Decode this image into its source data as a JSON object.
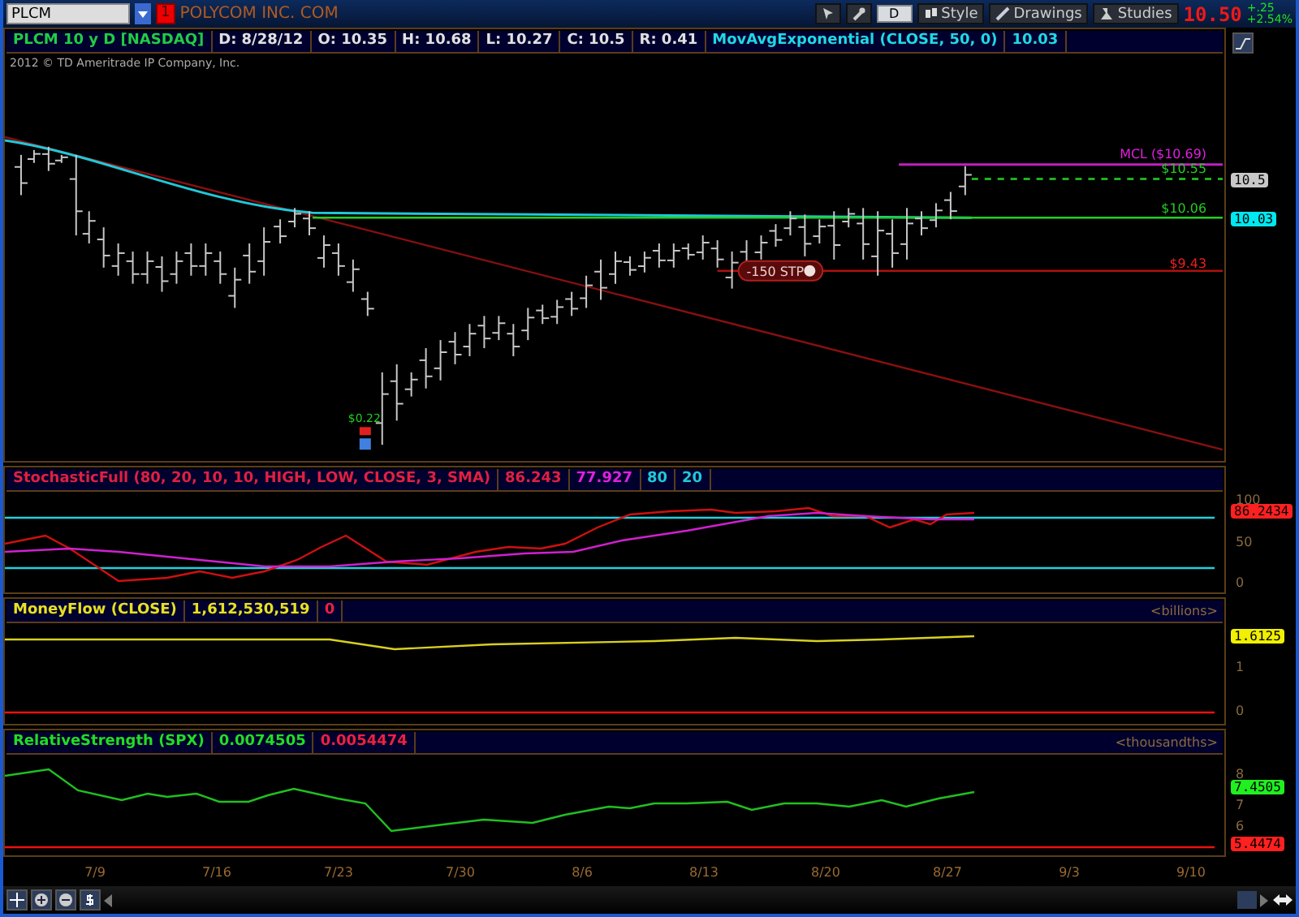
{
  "top_bar": {
    "symbol": "PLCM",
    "alert_badge": "1",
    "company": "POLYCOM INC. COM",
    "period": "D",
    "buttons": [
      {
        "kind": "style",
        "label": "Style"
      },
      {
        "kind": "drawings",
        "label": "Drawings"
      },
      {
        "kind": "studies",
        "label": "Studies"
      }
    ],
    "last_price": "10.50",
    "change": "+.25",
    "change_pct": "+2.54%"
  },
  "chart_header": [
    {
      "text": "PLCM 10 y D [NASDAQ]",
      "kind": "symbol"
    },
    {
      "text": "D: 8/28/12",
      "kind": "quote"
    },
    {
      "text": "O: 10.35",
      "kind": "quote"
    },
    {
      "text": "H: 10.68",
      "kind": "quote"
    },
    {
      "text": "L: 10.27",
      "kind": "quote"
    },
    {
      "text": "C: 10.5",
      "kind": "quote"
    },
    {
      "text": "R: 0.41",
      "kind": "quote"
    },
    {
      "text": "MovAvgExponential (CLOSE, 50, 0)",
      "kind": "average"
    },
    {
      "text": "10.03",
      "kind": "average"
    }
  ],
  "copyright": "2012 © TD Ameritrade IP Company, Inc.",
  "price_pane": {
    "levels": [
      {
        "text": "MCL ($10.69)",
        "color": "#e020e0"
      },
      {
        "text": "$10.55",
        "color": "#22cc22"
      },
      {
        "text": "$10.06",
        "color": "#22cc22"
      },
      {
        "text": "$9.43",
        "color": "#ee2020"
      }
    ],
    "axis_badges": [
      {
        "text": "10.5",
        "color": "#c8c8c8"
      },
      {
        "text": "10.03",
        "color": "#00e8f0"
      }
    ],
    "dividend": "$0.22",
    "order": "-150 STP"
  },
  "studies": [
    {
      "kind": "stochastic",
      "header": [
        {
          "text": "StochasticFull (80, 20, 10, 10, HIGH, LOW, CLOSE, 3, SMA)",
          "kind": "main"
        },
        {
          "text": "86.243",
          "kind": "main"
        },
        {
          "text": "77.927",
          "kind": "signal"
        },
        {
          "text": "80",
          "kind": "band"
        },
        {
          "text": "20",
          "kind": "band"
        }
      ],
      "ticks": [
        "100",
        "50",
        "0"
      ],
      "badges": [
        {
          "text": "86.2434",
          "color": "#ff2020"
        }
      ]
    },
    {
      "kind": "moneyflow",
      "header": [
        {
          "text": "MoneyFlow (CLOSE)",
          "kind": "flow"
        },
        {
          "text": "1,612,530,519",
          "kind": "flow"
        },
        {
          "text": "0",
          "kind": "reference"
        }
      ],
      "unit": "<billions>",
      "ticks": [
        "1",
        "0"
      ],
      "badges": [
        {
          "text": "1.6125",
          "color": "#f0f000"
        }
      ]
    },
    {
      "kind": "relstrength",
      "header": [
        {
          "text": "RelativeStrength (SPX)",
          "kind": "strength"
        },
        {
          "text": "0.0074505",
          "kind": "strength"
        },
        {
          "text": "0.0054474",
          "kind": "reference"
        }
      ],
      "unit": "<thousandths>",
      "ticks": [
        "8",
        "7",
        "6"
      ],
      "badges": [
        {
          "text": "7.4505",
          "color": "#20f020"
        },
        {
          "text": "5.4474",
          "color": "#ff2020"
        }
      ]
    }
  ],
  "dates": [
    "7/9",
    "7/16",
    "7/23",
    "7/30",
    "8/6",
    "8/13",
    "8/20",
    "8/27",
    "9/3",
    "9/10"
  ]
}
